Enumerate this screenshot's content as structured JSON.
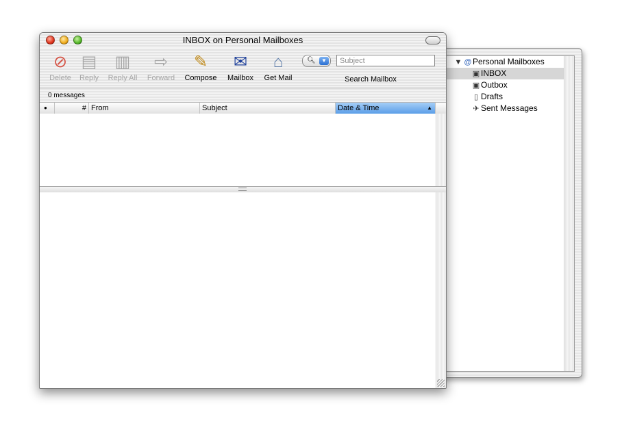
{
  "window": {
    "title": "INBOX on Personal Mailboxes"
  },
  "toolbar": {
    "buttons": [
      {
        "label": "Delete",
        "icon": "delete-icon",
        "enabled": false
      },
      {
        "label": "Reply",
        "icon": "reply-icon",
        "enabled": false
      },
      {
        "label": "Reply All",
        "icon": "reply-all-icon",
        "enabled": false
      },
      {
        "label": "Forward",
        "icon": "forward-icon",
        "enabled": false
      },
      {
        "label": "Compose",
        "icon": "pencil-icon",
        "enabled": true
      },
      {
        "label": "Mailbox",
        "icon": "mailbox-icon",
        "enabled": true
      },
      {
        "label": "Get Mail",
        "icon": "get-mail-icon",
        "enabled": true
      }
    ],
    "search": {
      "placeholder": "Subject",
      "label": "Search Mailbox"
    }
  },
  "status": {
    "text": "0 messages"
  },
  "columns": {
    "status": "●",
    "number": "#",
    "from": "From",
    "subject": "Subject",
    "date": "Date & Time",
    "sorted_column": "Date & Time",
    "sort_indicator": "▲"
  },
  "drawer": {
    "account": "Personal Mailboxes",
    "mailboxes": [
      {
        "label": "INBOX",
        "icon": "inbox-icon",
        "selected": true
      },
      {
        "label": "Outbox",
        "icon": "outbox-icon",
        "selected": false
      },
      {
        "label": "Drafts",
        "icon": "drafts-icon",
        "selected": false
      },
      {
        "label": "Sent Messages",
        "icon": "sent-icon",
        "selected": false
      }
    ]
  },
  "colors": {
    "accent": "#5b9ee8",
    "selection": "#d6d6d6"
  }
}
